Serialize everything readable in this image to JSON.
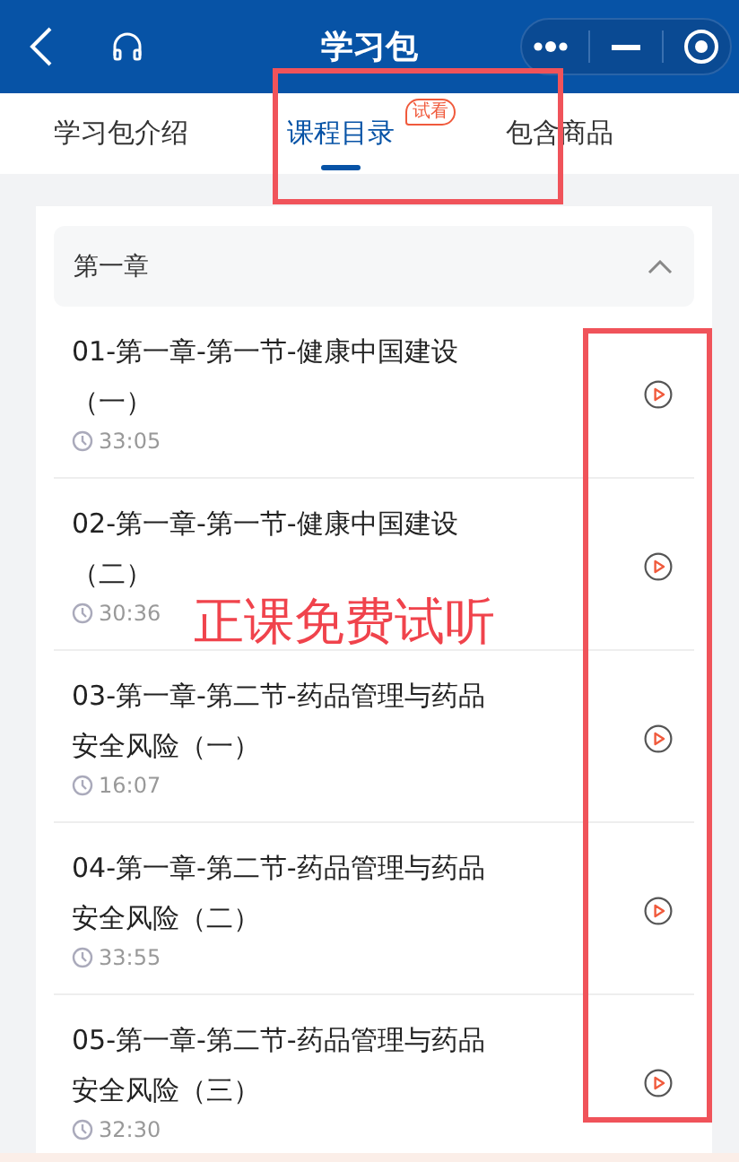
{
  "header": {
    "title": "学习包"
  },
  "tabs": [
    {
      "label": "学习包介绍",
      "selected": false
    },
    {
      "label": "课程目录",
      "selected": true,
      "badge": "试看"
    },
    {
      "label": "包含商品",
      "selected": false
    }
  ],
  "chapter": {
    "title": "第一章",
    "expanded": true
  },
  "lessons": [
    {
      "title": "01-第一章-第一节-健康中国建设（一）",
      "duration": "33:05"
    },
    {
      "title": "02-第一章-第一节-健康中国建设（二）",
      "duration": "30:36"
    },
    {
      "title": "03-第一章-第二节-药品管理与药品安全风险（一）",
      "duration": "16:07"
    },
    {
      "title": "04-第一章-第二节-药品管理与药品安全风险（二）",
      "duration": "33:55"
    },
    {
      "title": "05-第一章-第二节-药品管理与药品安全风险（三）",
      "duration": "32:30"
    }
  ],
  "annotation": {
    "text": "正课免费试听"
  }
}
